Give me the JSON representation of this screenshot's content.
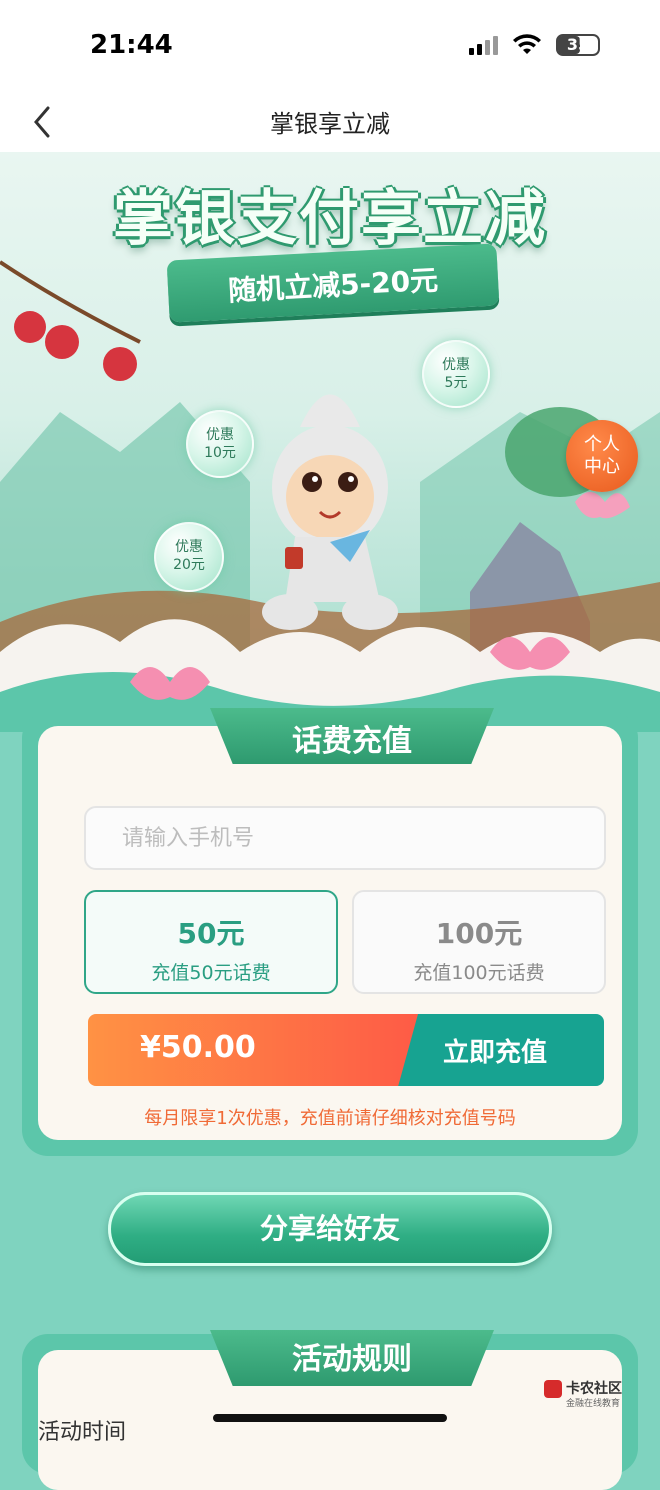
{
  "status_bar": {
    "time": "21:44",
    "battery": "35"
  },
  "nav": {
    "title": "掌银享立减"
  },
  "banner": {
    "title": "掌银支付享立减",
    "ribbon": "随机立减5-20元",
    "bubbles": [
      {
        "line1": "优惠",
        "line2": "5元"
      },
      {
        "line1": "优惠",
        "line2": "10元"
      },
      {
        "line1": "优惠",
        "line2": "20元"
      }
    ],
    "center_link": {
      "line1": "个人",
      "line2": "中心"
    }
  },
  "recharge": {
    "tab_title": "话费充值",
    "phone_placeholder": "请输入手机号",
    "options": [
      {
        "amount": "50元",
        "desc": "充值50元话费",
        "selected": true
      },
      {
        "amount": "100元",
        "desc": "充值100元话费",
        "selected": false
      }
    ],
    "price": "¥50.00",
    "submit_label": "立即充值",
    "notice": "每月限享1次优惠，充值前请仔细核对充值号码"
  },
  "share_label": "分享给好友",
  "rules": {
    "tab_title": "活动规则",
    "first_item": "活动时间"
  },
  "watermark": {
    "name": "卡农社区",
    "sub": "金融在线教育"
  },
  "colors": {
    "accent": "#2fa688",
    "price_orange": "#fe5b46",
    "submit_teal": "#17a391",
    "notice": "#f06a36"
  }
}
